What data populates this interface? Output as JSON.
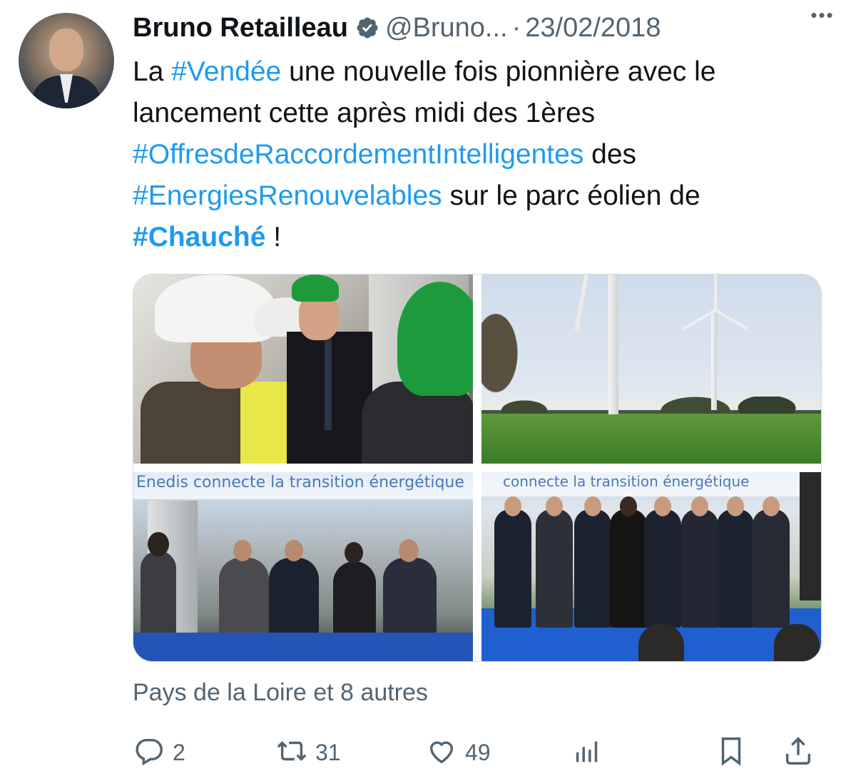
{
  "author": {
    "display_name": "Bruno Retailleau",
    "handle": "@Bruno...",
    "separator": "·",
    "date": "23/02/2018"
  },
  "tweet": {
    "segments": [
      {
        "text": "La ",
        "type": "text"
      },
      {
        "text": "#Vendée",
        "type": "tag"
      },
      {
        "text": " une nouvelle fois pionnière avec le lancement cette après midi des 1ères ",
        "type": "text"
      },
      {
        "text": "#OffresdeRaccordementIntelligentes",
        "type": "tag"
      },
      {
        "text": " des ",
        "type": "text"
      },
      {
        "text": "#EnergiesRenouvelables",
        "type": "tag"
      },
      {
        "text": " sur le parc éolien de ",
        "type": "text"
      },
      {
        "text": "#Chauché",
        "type": "tag-bold"
      },
      {
        "text": " !",
        "type": "text"
      }
    ]
  },
  "media": {
    "photo3_banner": "Enedis connecte la transition énergétique",
    "photo4_banner": "connecte la transition énergétique"
  },
  "location": "Pays de la Loire et 8 autres",
  "actions": {
    "replies": "2",
    "retweets": "31",
    "likes": "49"
  },
  "icons": {
    "verified": "verified-badge-icon",
    "more": "more-dots-icon",
    "reply": "reply-icon",
    "retweet": "retweet-icon",
    "like": "heart-icon",
    "views": "analytics-icon",
    "bookmark": "bookmark-icon",
    "share": "share-icon"
  },
  "colors": {
    "link": "#1d9bf0",
    "secondary_text": "#536471",
    "primary_text": "#0f1419"
  }
}
